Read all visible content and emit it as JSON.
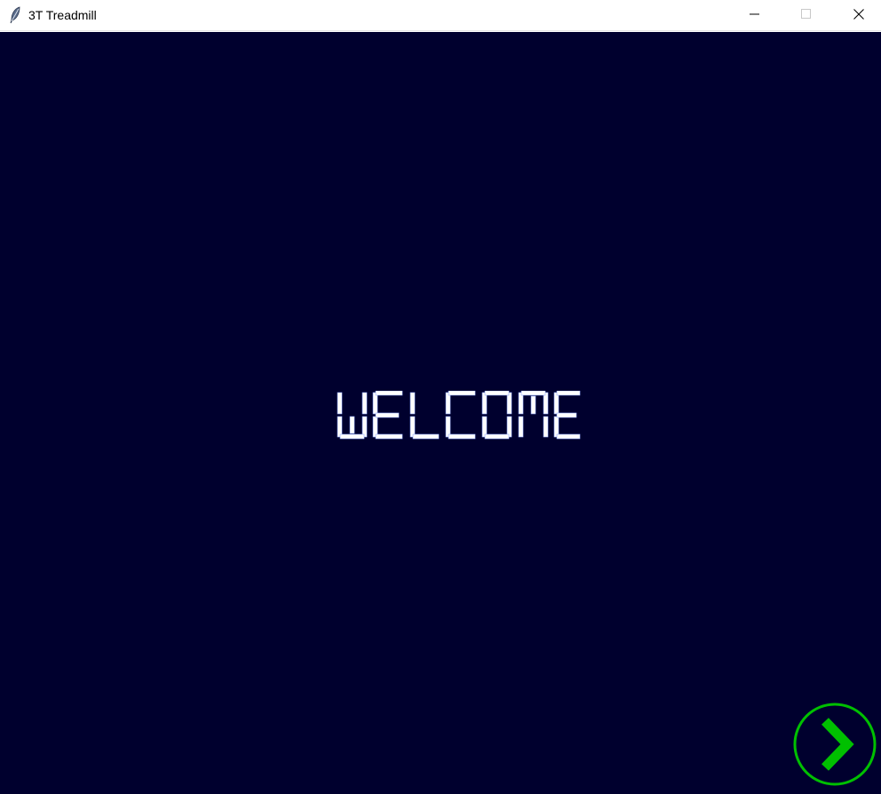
{
  "window": {
    "title": "3T Treadmill",
    "app_icon": "feather-icon",
    "controls": [
      "minimize-icon",
      "maximize-icon",
      "close-icon"
    ]
  },
  "screen": {
    "background_color": "#00002e",
    "welcome_text": "WELCOME",
    "welcome_color": "#ffffff",
    "next_button": {
      "icon": "chevron-right-icon",
      "color": "#00c000"
    }
  }
}
